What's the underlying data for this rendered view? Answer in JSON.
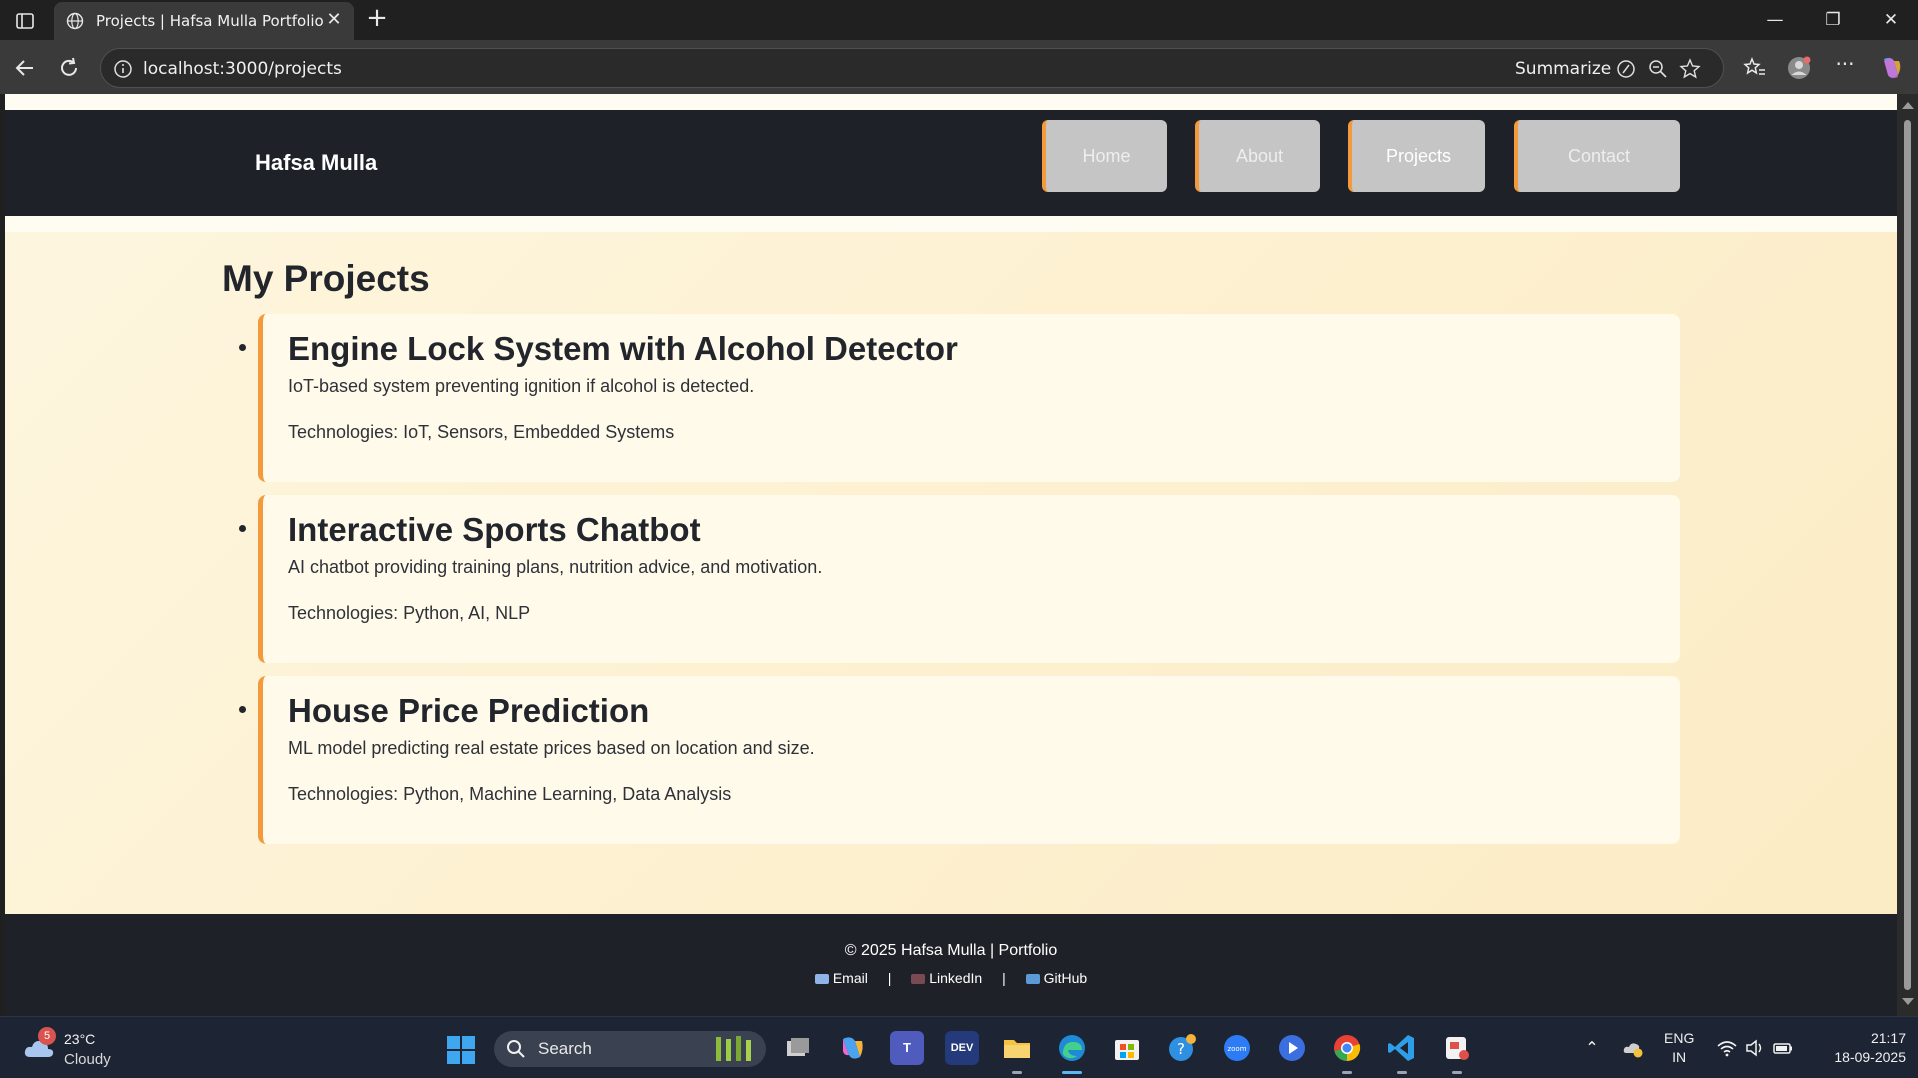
{
  "browser": {
    "tab_title": "Projects | Hafsa Mulla Portfolio",
    "url": "localhost:3000/projects",
    "summarize_label": "Summarize"
  },
  "site": {
    "brand": "Hafsa Mulla",
    "nav": [
      {
        "label": "Home"
      },
      {
        "label": "About"
      },
      {
        "label": "Projects",
        "active": true
      },
      {
        "label": "Contact"
      }
    ],
    "accent_color": "#f39a3d",
    "header_color": "#1e2228"
  },
  "main": {
    "title": "My Projects",
    "projects": [
      {
        "title": "Engine Lock System with Alcohol Detector",
        "description": "IoT-based system preventing ignition if alcohol is detected.",
        "technologies": "Technologies: IoT, Sensors, Embedded Systems"
      },
      {
        "title": "Interactive Sports Chatbot",
        "description": "AI chatbot providing training plans, nutrition advice, and motivation.",
        "technologies": "Technologies: Python, AI, NLP"
      },
      {
        "title": "House Price Prediction",
        "description": "ML model predicting real estate prices based on location and size.",
        "technologies": "Technologies: Python, Machine Learning, Data Analysis"
      }
    ]
  },
  "footer": {
    "copyright": "© 2025 Hafsa Mulla | Portfolio",
    "links": [
      {
        "label": "Email",
        "icon": "email-icon"
      },
      {
        "label": "LinkedIn",
        "icon": "briefcase-icon"
      },
      {
        "label": "GitHub",
        "icon": "laptop-icon"
      }
    ],
    "separator": "|"
  },
  "taskbar": {
    "weather_badge": "5",
    "temperature": "23°C",
    "condition": "Cloudy",
    "search_label": "Search",
    "lang_line1": "ENG",
    "lang_line2": "IN",
    "time": "21:17",
    "date": "18-09-2025",
    "apps": [
      "task-view",
      "copilot",
      "teams",
      "dev-home",
      "file-explorer",
      "edge",
      "microsoft-store",
      "help",
      "zoom",
      "media-player",
      "chrome",
      "vscode",
      "snipping-tool"
    ]
  }
}
